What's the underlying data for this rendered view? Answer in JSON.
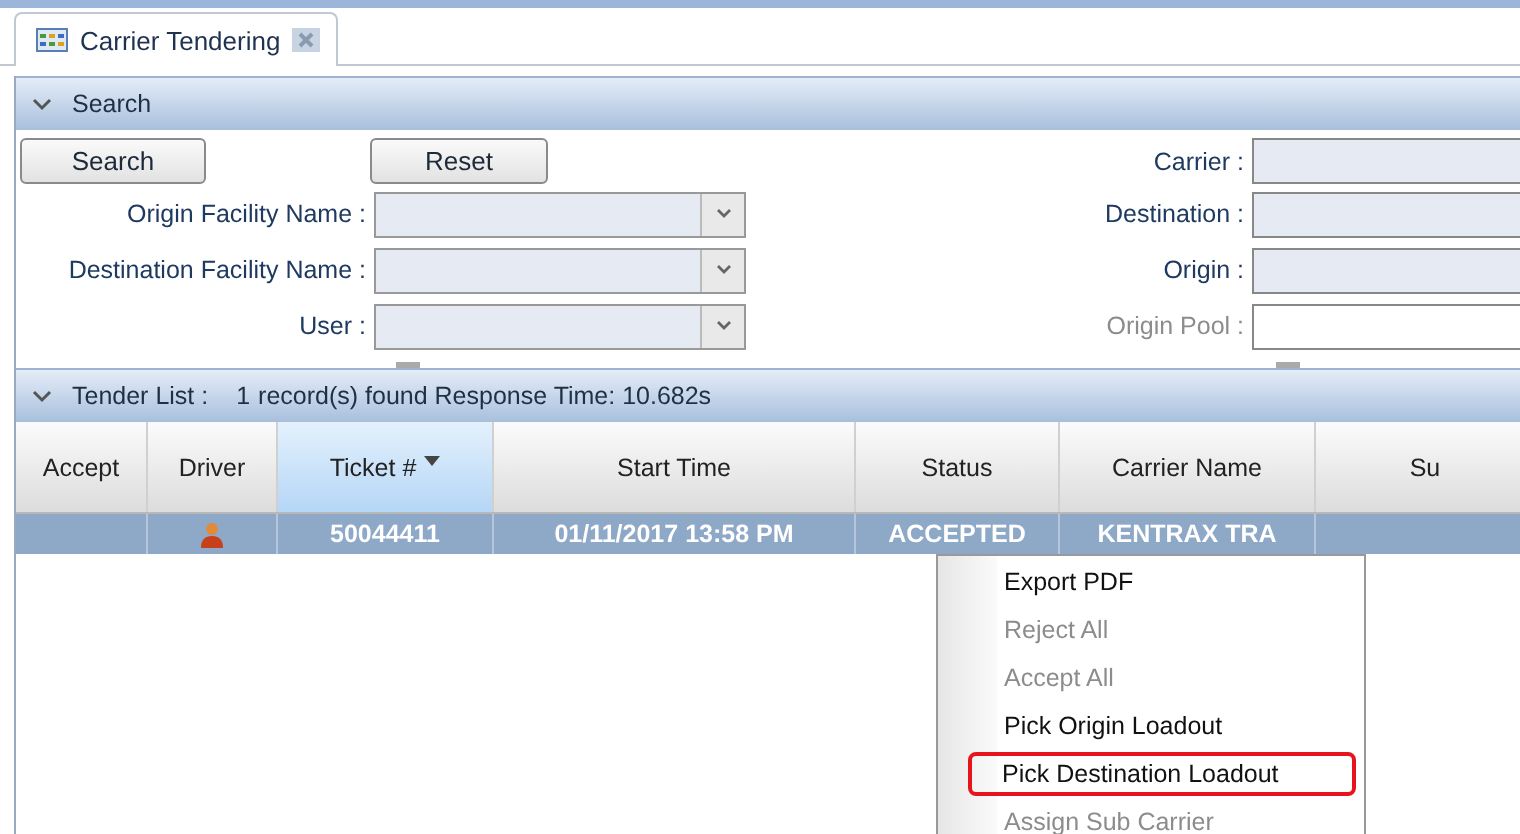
{
  "tab": {
    "title": "Carrier Tendering"
  },
  "search": {
    "title": "Search",
    "expanded": true,
    "buttons": [
      "Search",
      "Reset"
    ],
    "left_fields": [
      {
        "label": "Origin Facility Name :"
      },
      {
        "label": "Destination Facility Name :"
      },
      {
        "label": "User :"
      }
    ],
    "right_fields": [
      {
        "label": "Carrier :",
        "disabled": false
      },
      {
        "label": "Destination :",
        "disabled": false
      },
      {
        "label": "Origin :",
        "disabled": false
      },
      {
        "label": "Origin Pool :",
        "disabled": true
      }
    ]
  },
  "tender_list": {
    "title": "Tender List :",
    "expanded": true,
    "count": "1",
    "summary": "record(s) found Response Time: 10.682s"
  },
  "table": {
    "columns": [
      {
        "label": "Accept",
        "sorted": false
      },
      {
        "label": "Driver",
        "sorted": false
      },
      {
        "label": "Ticket #",
        "sorted": true
      },
      {
        "label": "Start Time",
        "sorted": false
      },
      {
        "label": "Status",
        "sorted": false
      },
      {
        "label": "Carrier Name",
        "sorted": false
      },
      {
        "label": "Su",
        "sorted": false
      }
    ],
    "rows": [
      {
        "selected": true,
        "ticket": "50044411",
        "start_time": "01/11/2017 13:58 PM",
        "status": "ACCEPTED",
        "carrier_name": "KENTRAX TRA"
      }
    ]
  },
  "context_menu": {
    "items": [
      {
        "label": "Export PDF",
        "disabled": false,
        "highlighted": false
      },
      {
        "label": "Reject All",
        "disabled": true,
        "highlighted": false
      },
      {
        "label": "Accept All",
        "disabled": true,
        "highlighted": false
      },
      {
        "label": "Pick Origin Loadout",
        "disabled": false,
        "highlighted": false
      },
      {
        "label": "Pick Destination Loadout",
        "disabled": false,
        "highlighted": true
      },
      {
        "label": "Assign Sub Carrier",
        "disabled": true,
        "highlighted": false
      }
    ]
  }
}
